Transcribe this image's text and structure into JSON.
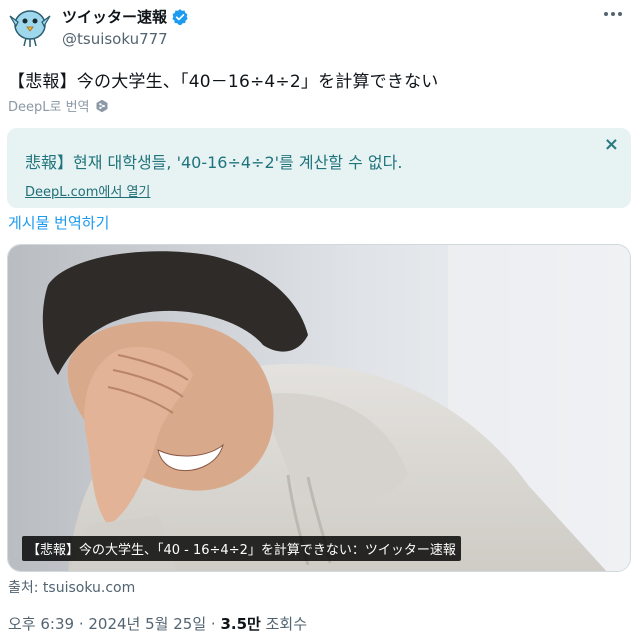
{
  "author": {
    "display_name": "ツイッター速報",
    "handle": "@tsuisoku777",
    "verified": true
  },
  "tweet": {
    "text": "【悲報】今の大学生、「40－16÷4÷2」を計算できない"
  },
  "deepl": {
    "label": "DeepL로 번역",
    "translation": "悲報】현재 대학생들, '40-16÷4÷2'를 계산할 수 없다.",
    "open_link": "DeepL.com에서 열기",
    "close_symbol": "×"
  },
  "translate_post": "게시물 번역하기",
  "media": {
    "caption": "【悲報】今の大学生、「40 - 16÷4÷2」を計算できない：ツイッター速報"
  },
  "source": "출처: tsuisoku.com",
  "meta": {
    "time": "오후 6:39",
    "date": "2024년 5월 25일",
    "separator": " · ",
    "views_count": "3.5만",
    "views_label": "조회수"
  },
  "colors": {
    "verified": "#1d9bf0",
    "link": "#1d9bf0",
    "translation_bg": "#e7f2f2",
    "translation_text": "#20747c"
  },
  "icons": [
    "bird-avatar-icon",
    "verified-badge-icon",
    "more-icon",
    "deepl-icon",
    "close-icon"
  ]
}
